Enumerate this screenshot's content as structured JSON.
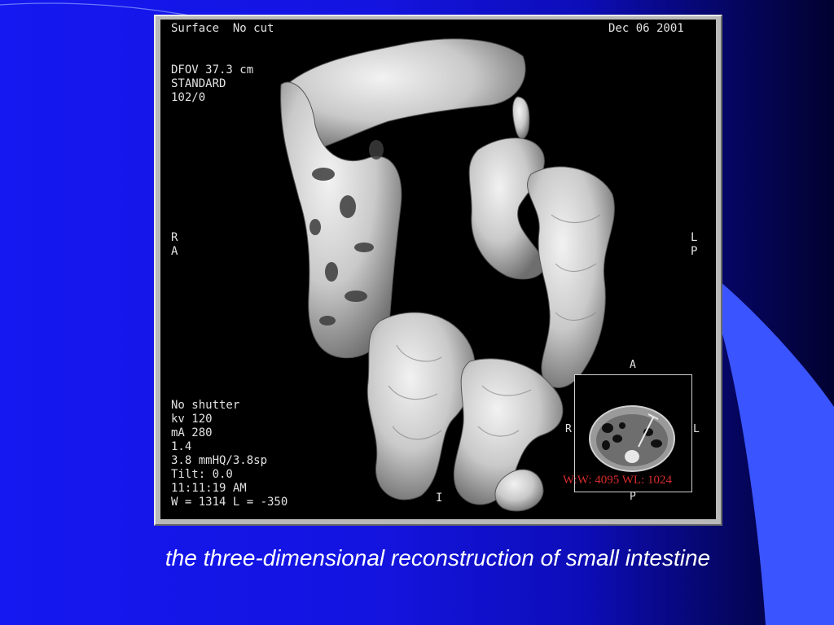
{
  "slide": {
    "caption": "the three-dimensional reconstruction of small intestine",
    "background_color": "#1414e0",
    "accent_color": "#3355ff"
  },
  "ct_image": {
    "header_left": "Surface  No cut",
    "header_right": "Dec 06 2001",
    "info_top_left": [
      "DFOV 37.3 cm",
      "STANDARD",
      "102/0"
    ],
    "orientation_left": [
      "R",
      "A"
    ],
    "orientation_right": [
      "L",
      "P"
    ],
    "bottom_marker": "I",
    "scan_params": [
      "No shutter",
      "kv 120",
      "mA 280",
      "1.4",
      "3.8 mmHQ/3.8sp",
      "Tilt: 0.0",
      "11:11:19 AM",
      "W = 1314 L = -350"
    ],
    "inset": {
      "label_top": "A",
      "label_bottom": "P",
      "label_left": "R",
      "label_right": "L",
      "window_text": "W:W: 4095 WL: 1024",
      "window_text_color": "#d52c2c"
    }
  }
}
